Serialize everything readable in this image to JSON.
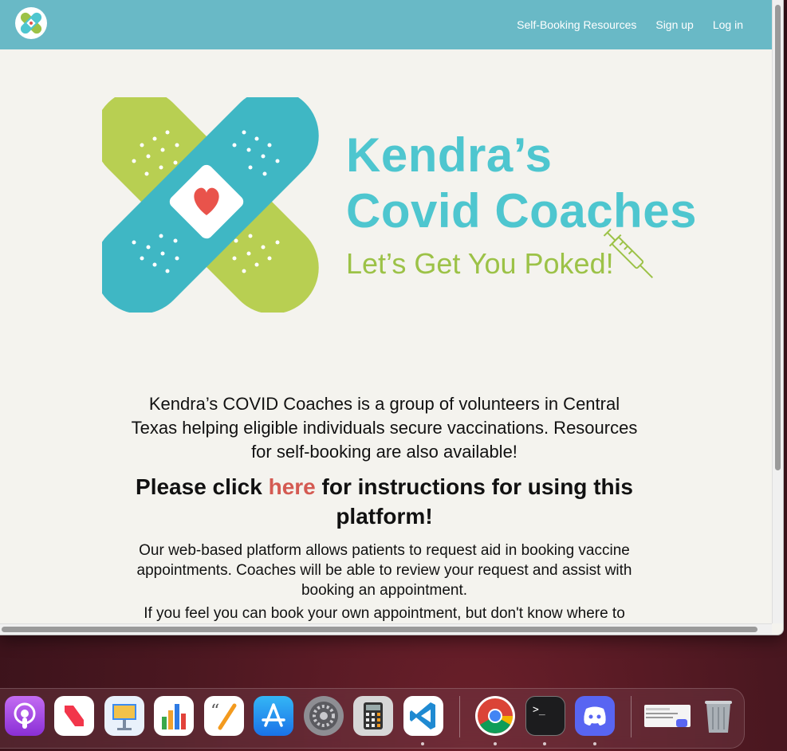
{
  "navbar": {
    "links": [
      "Self-Booking Resources",
      "Sign up",
      "Log in"
    ]
  },
  "hero": {
    "title_line1": "Kendra’s",
    "title_line2": "Covid Coaches",
    "tagline": "Let’s Get You Poked!"
  },
  "content": {
    "intro": "Kendra’s COVID Coaches is a group of volunteers in Central Texas helping eligible individuals secure vaccinations. Resources for self-booking are also available!",
    "click_prefix": "Please click ",
    "click_link": "here",
    "click_suffix": " for instructions for using this platform!",
    "description": "Our web-based platform allows patients to request aid in booking vaccine appointments. Coaches will be able to review your request and assist with booking an appointment.",
    "cut_off_line": "If you feel you can book your own appointment, but don't know where to start"
  },
  "colors": {
    "navbar": "#69b9c6",
    "teal": "#4ec6cf",
    "green": "#9cc247",
    "link": "#d45a52",
    "page_bg": "#f4f3ee"
  },
  "dock": {
    "apps": [
      "podcasts-icon",
      "news-icon",
      "keynote-icon",
      "numbers-icon",
      "pages-icon",
      "app-store-icon",
      "system-preferences-icon",
      "calculator-icon",
      "vscode-icon",
      "chrome-icon",
      "terminal-icon",
      "discord-icon",
      "window-preview-icon",
      "trash-icon"
    ]
  }
}
